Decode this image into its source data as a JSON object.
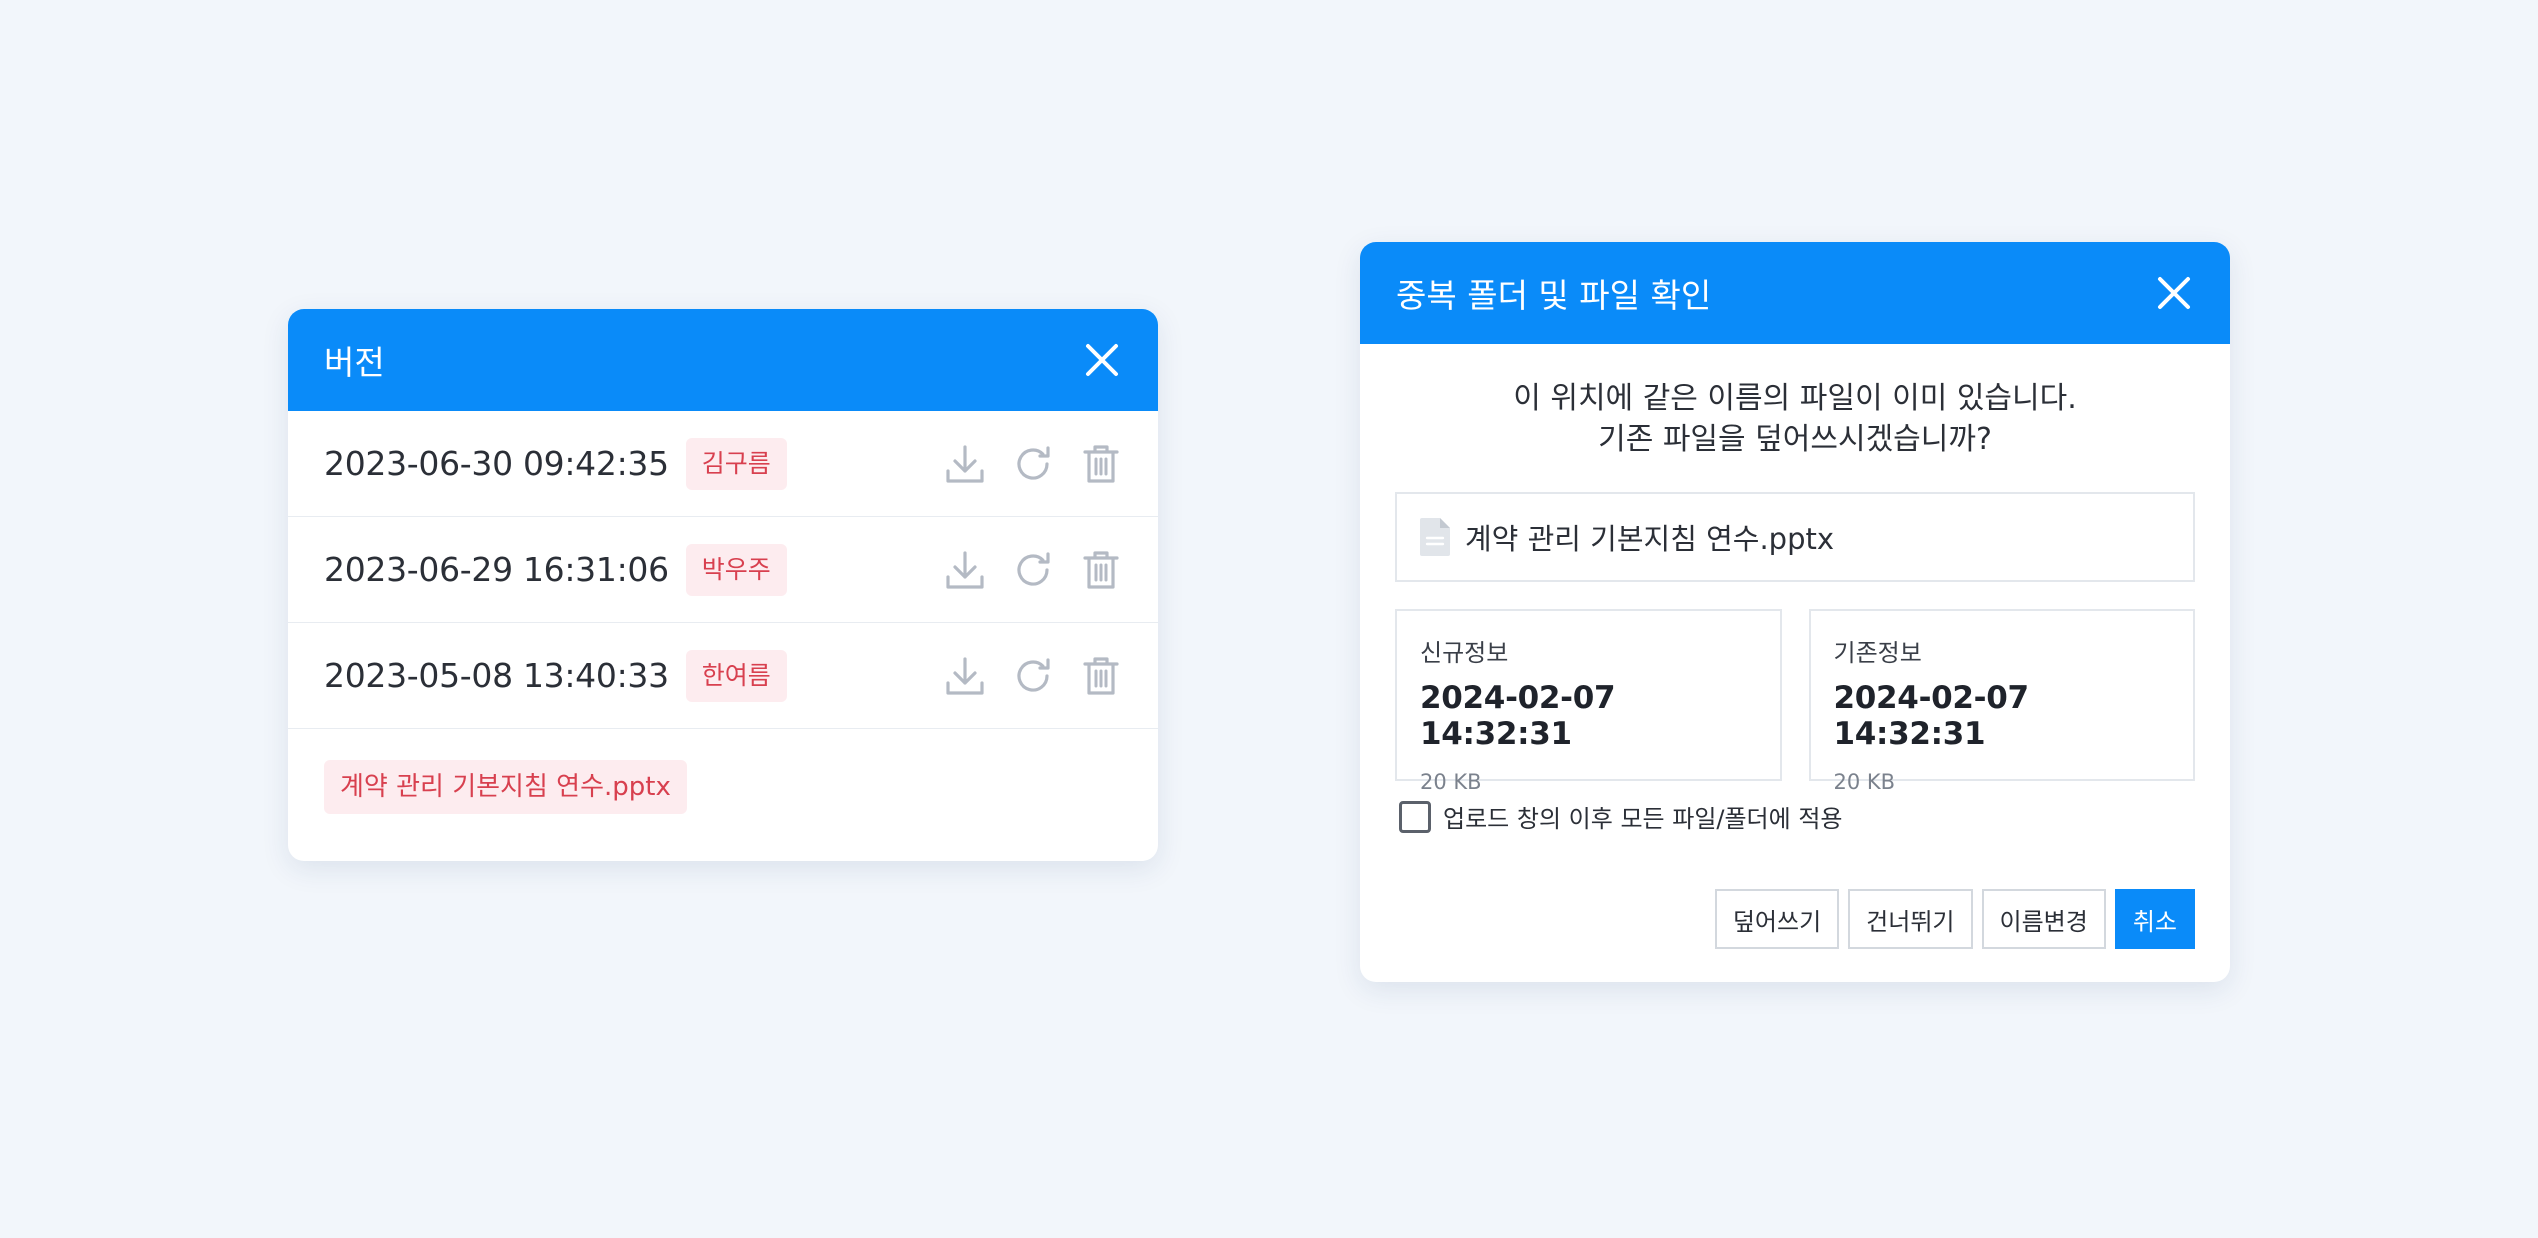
{
  "version_dialog": {
    "title": "버전",
    "versions": [
      {
        "date": "2023-06-30 09:42:35",
        "author": "김구름"
      },
      {
        "date": "2023-06-29 16:31:06",
        "author": "박우주"
      },
      {
        "date": "2023-05-08 13:40:33",
        "author": "한여름"
      }
    ],
    "file_name": "계약 관리 기본지침 연수.pptx"
  },
  "duplicate_dialog": {
    "title": "중복 폴더 및 파일 확인",
    "message_line1": "이 위치에 같은 이름의 파일이 이미 있습니다.",
    "message_line2": "기존 파일을 덮어쓰시겠습니까?",
    "file_name": "계약 관리 기본지침 연수.pptx",
    "new_info": {
      "label": "신규정보",
      "date": "2024-02-07 14:32:31",
      "size": "20 KB"
    },
    "existing_info": {
      "label": "기존정보",
      "date": "2024-02-07 14:32:31",
      "size": "20 KB"
    },
    "apply_all_label": "업로드 창의 이후 모든 파일/폴더에 적용",
    "apply_all_checked": false,
    "buttons": {
      "overwrite": "덮어쓰기",
      "skip": "건너뛰기",
      "rename": "이름변경",
      "cancel": "취소"
    }
  },
  "colors": {
    "accent": "#0a8bf9",
    "badge_bg": "#fdecef",
    "badge_text": "#d8404f",
    "icon_gray": "#b4bac4",
    "background": "#f2f6fb"
  },
  "icons": {
    "close": "close-icon",
    "download": "download-icon",
    "restore": "restore-icon",
    "delete": "trash-icon",
    "file": "document-icon"
  }
}
